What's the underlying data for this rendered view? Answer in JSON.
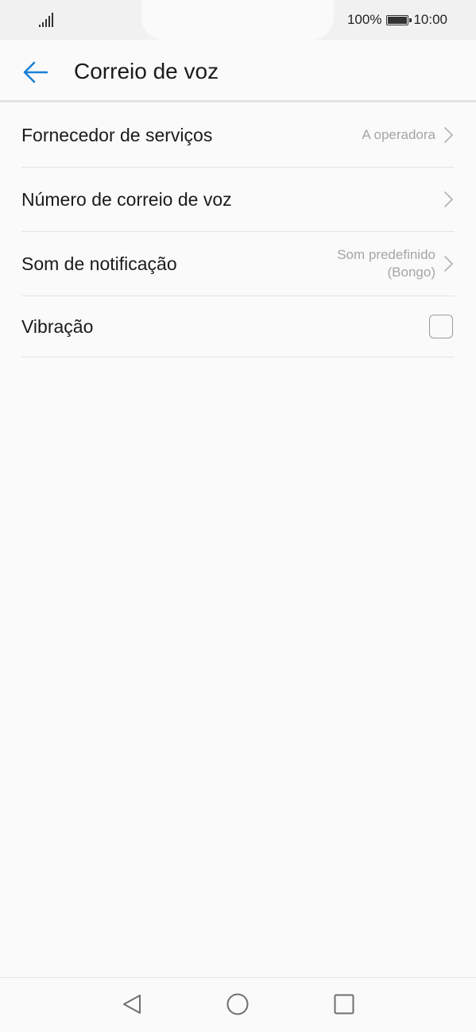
{
  "status_bar": {
    "battery_percent": "100%",
    "time": "10:00",
    "signal_icon": "signal-icon",
    "battery_icon": "battery-icon"
  },
  "header": {
    "title": "Correio de voz",
    "back_icon": "arrow-back-icon",
    "accent_color": "#1a7fd6"
  },
  "settings": {
    "items": [
      {
        "label": "Fornecedor de serviços",
        "value": "A operadora",
        "control": "chevron"
      },
      {
        "label": "Número de correio de voz",
        "value": "",
        "control": "chevron"
      },
      {
        "label": "Som de notificação",
        "value_line1": "Som predefinido",
        "value_line2": "(Bongo)",
        "control": "chevron"
      },
      {
        "label": "Vibração",
        "checked": false,
        "control": "checkbox"
      }
    ]
  },
  "nav_bar": {
    "back_icon": "nav-back-icon",
    "home_icon": "nav-home-icon",
    "recents_icon": "nav-recents-icon"
  }
}
